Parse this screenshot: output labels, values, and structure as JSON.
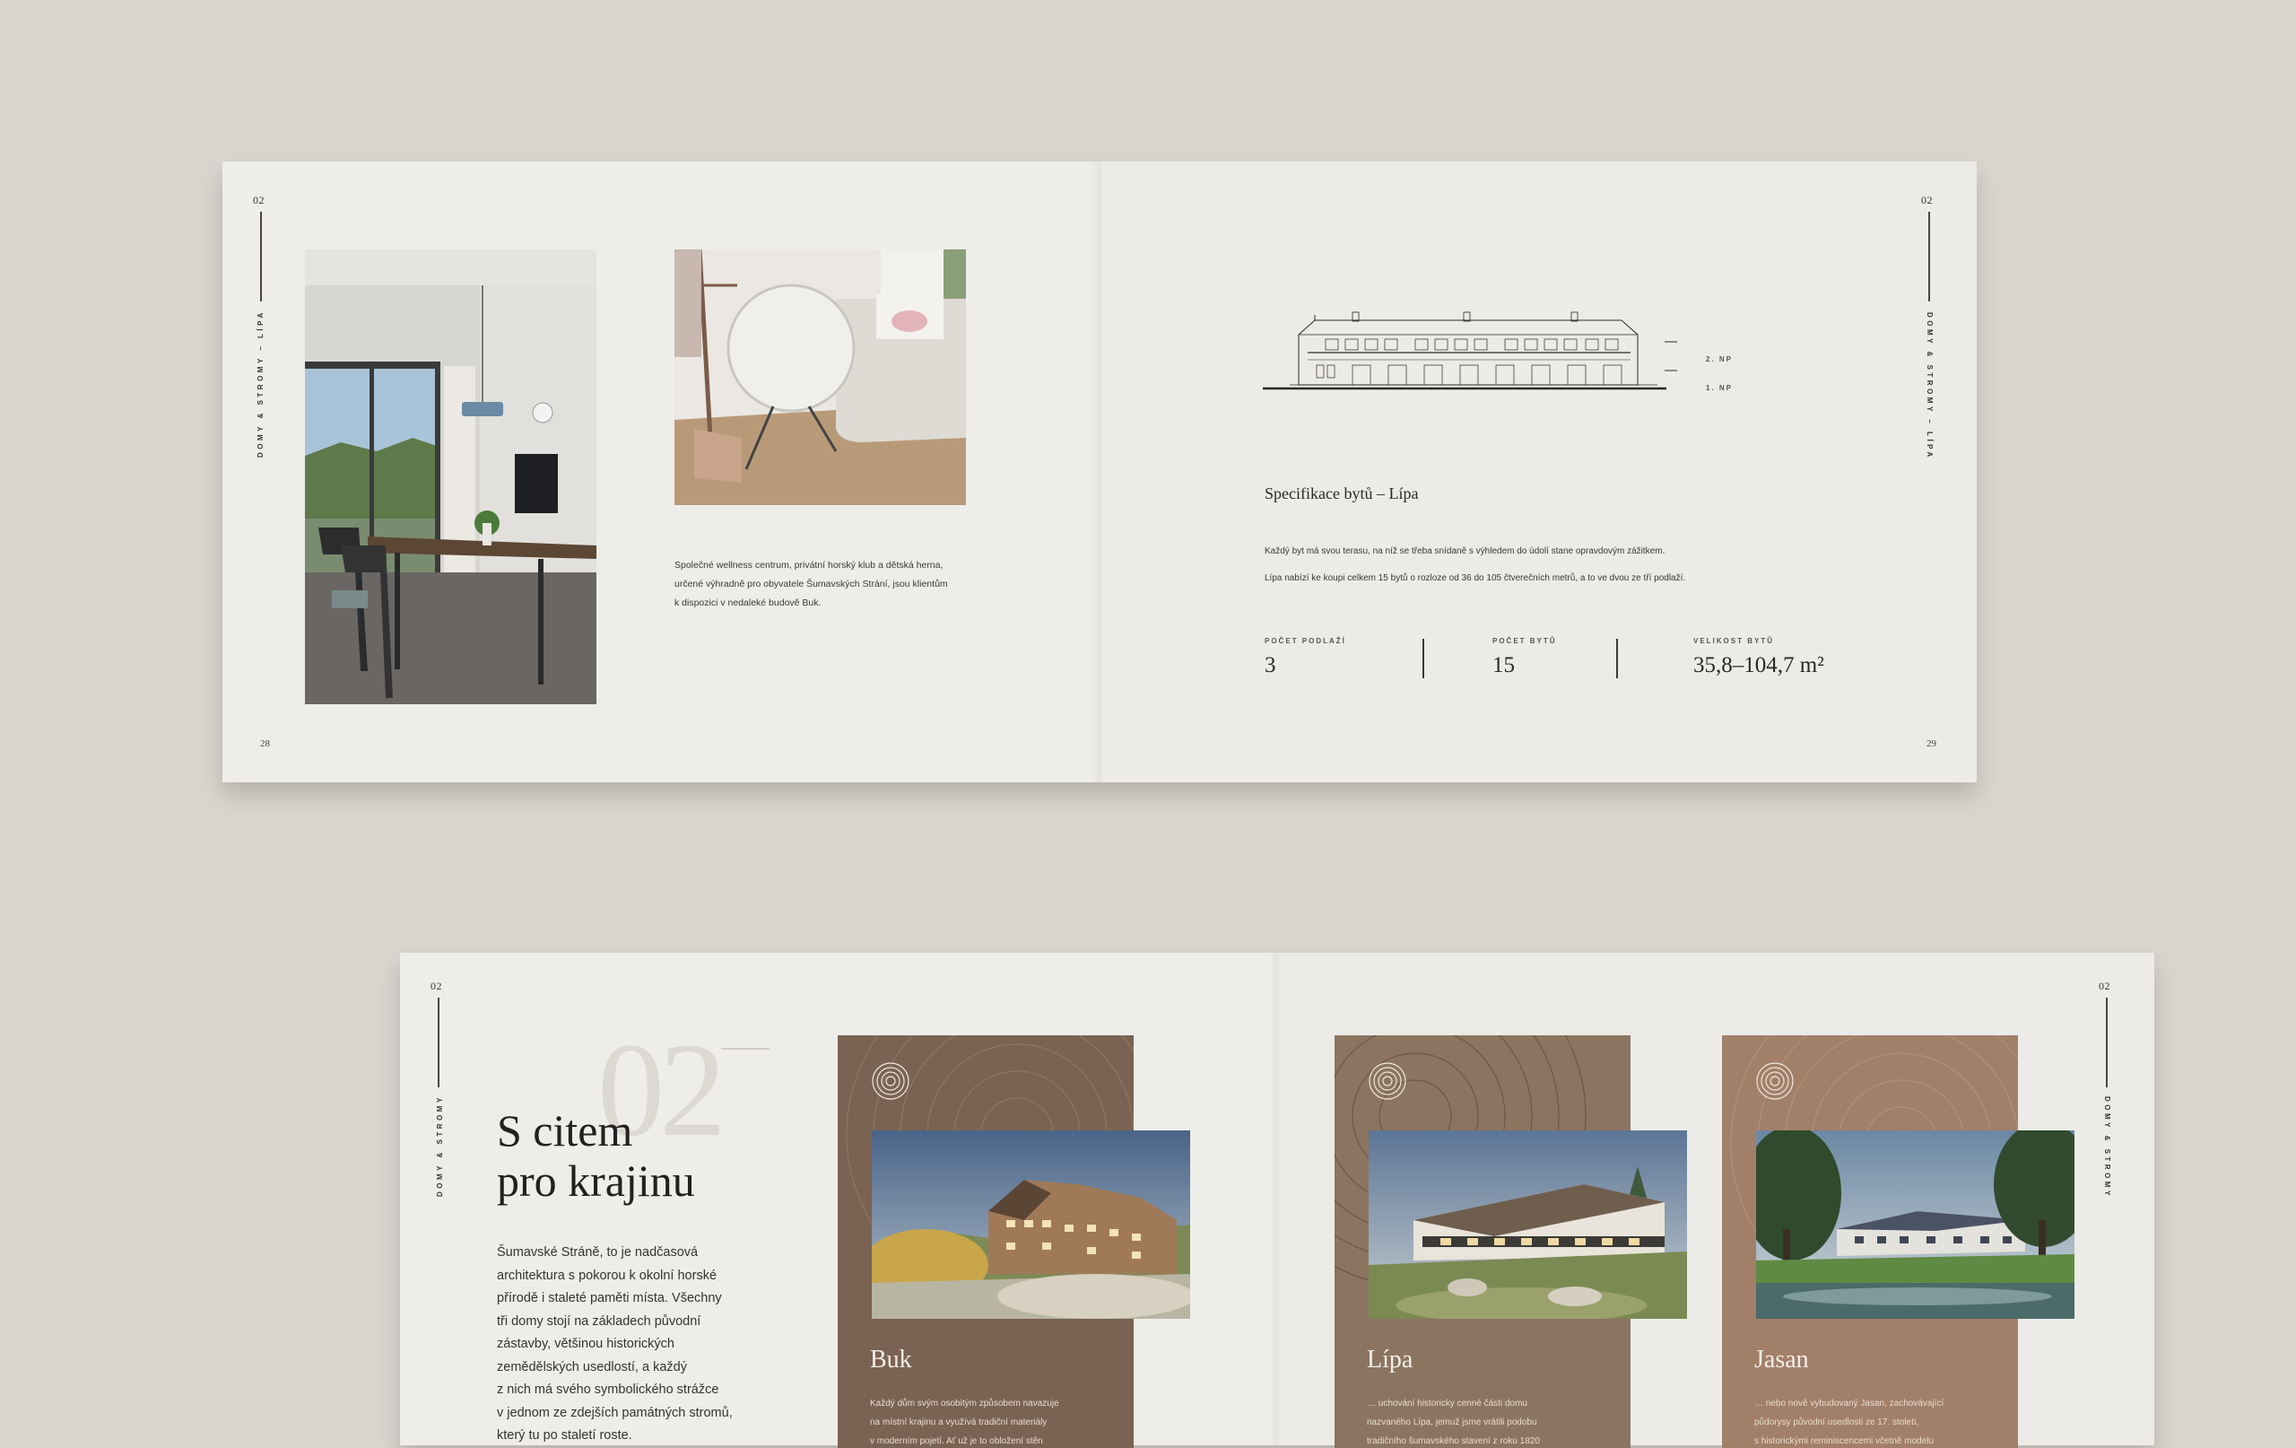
{
  "top_spread": {
    "left_page": {
      "chapter_number": "02",
      "running_head": "DOMY & STROMY – LÍPA",
      "page_number": "28",
      "paragraph_lines": [
        "Společné wellness centrum, privátní horský klub a dětská herna,",
        "určené výhradně pro obyvatele Šumavských Strání, jsou klientům",
        "k dispozici v nedaleké budově Buk."
      ]
    },
    "right_page": {
      "chapter_number": "02",
      "running_head": "DOMY & STROMY – LÍPA",
      "page_number": "29",
      "floor_labels": [
        "2. NP",
        "1. NP"
      ],
      "heading": "Specifikace bytů – Lípa",
      "paragraph_lines": [
        "Každý byt má svou terasu, na níž se třeba snídaně s výhledem do údolí stane opravdovým zážitkem.",
        "Lípa nabízí ke koupi celkem 15 bytů o rozloze od 36 do 105 čtverečních metrů, a to ve dvou ze tří podlaží."
      ],
      "stats": [
        {
          "label": "POČET PODLAŽÍ",
          "value": "3"
        },
        {
          "label": "POČET BYTŮ",
          "value": "15"
        },
        {
          "label": "VELIKOST BYTŮ",
          "value": "35,8–104,7 m²"
        }
      ]
    }
  },
  "bottom_spread": {
    "left_page": {
      "chapter_number": "02",
      "running_head": "DOMY & STROMY",
      "big_numeral": "02",
      "heading_lines": [
        "S citem",
        "pro krajinu"
      ],
      "paragraph_lines": [
        "Šumavské Stráně, to je nadčasová",
        "architektura s pokorou k okolní horské",
        "přírodě i staleté paměti místa. Všechny",
        "tři domy stojí na základech původní",
        "zástavby, většinou historických",
        "zemědělských usedlostí, a každý",
        "z nich má svého symbolického strážce",
        "v jednom ze zdejších památných stromů,",
        "který tu po staletí roste."
      ]
    },
    "right_page": {
      "chapter_number": "02",
      "running_head": "DOMY & STROMY"
    },
    "cards": [
      {
        "title": "Buk",
        "color": "#7a6352",
        "text_lines": [
          "Každý dům svým osobitým způsobem navazuje",
          "na místní krajinu a využívá tradiční materiály",
          "v moderním pojetí. Ať už je to obložení stěn"
        ]
      },
      {
        "title": "Lípa",
        "color": "#8c7560",
        "text_lines": [
          "… uchování historicky cenné části domu",
          "nazvaného Lípa, jemuž jsme vrátili podobu",
          "tradičního šumavského stavení z roku 1820"
        ]
      },
      {
        "title": "Jasan",
        "color": "#a27f69",
        "text_lines": [
          "… nebo nově vybudovaný Jasan, zachovávající",
          "půdorysy původní usedlosti ze 17. století,",
          "s historickými reminiscencemi včetně modelu"
        ]
      }
    ]
  }
}
